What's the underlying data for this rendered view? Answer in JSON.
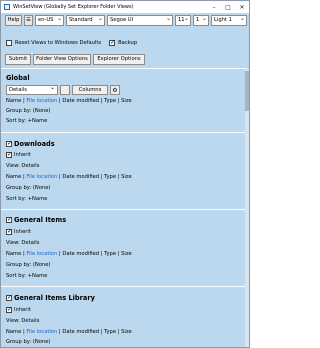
{
  "window": {
    "title": "WinSetView (Globally Set Explorer Folder Views)"
  },
  "toolbar": {
    "help": "Help",
    "menu": "☰",
    "lang": "en-US",
    "preset": "Standard",
    "font": "Segoe UI",
    "font_size": "11",
    "scale": "1",
    "theme": "Light 1"
  },
  "options": {
    "reset_views": "Reset Views to Windows Defaults",
    "backup": "Backup"
  },
  "buttons": {
    "submit": "Submit",
    "folder_view_options": "Folder View Options",
    "explorer_options": "Explorer Options"
  },
  "global": {
    "heading": "Global",
    "view": "Details",
    "columns_btn": "Columns",
    "line1_prefix": "Name | ",
    "line1_loc": "File location",
    "line1_suffix": " | Date modified | Type | Size",
    "group": "Group by: (None)",
    "sort": "Sort by: +Name"
  },
  "sections": [
    {
      "heading": "Downloads",
      "inherit": "Inherit",
      "view": "View: Details",
      "line1_prefix": "Name | ",
      "line1_loc": "File location",
      "line1_suffix": " | Date modified | Type | Size",
      "group": "Group by: (None)",
      "sort": "Sort by: +Name"
    },
    {
      "heading": "General Items",
      "inherit": "Inherit",
      "view": "View: Details",
      "line1_prefix": "Name | ",
      "line1_loc": "File location",
      "line1_suffix": " | Date modified | Type | Size",
      "group": "Group by: (None)",
      "sort": "Sort by: +Name"
    },
    {
      "heading": "General Items Library",
      "inherit": "Inherit",
      "view": "View: Details",
      "line1_prefix": "Name | ",
      "line1_loc": "File location",
      "line1_suffix": " | Date modified | Type | Size",
      "group": "Group by: (None)"
    }
  ],
  "colors": {
    "background": "#bcd8ee",
    "link": "#1f62c9"
  }
}
